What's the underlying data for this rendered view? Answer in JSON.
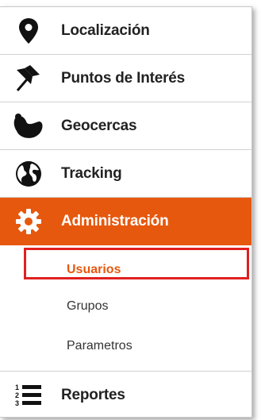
{
  "menu": {
    "items": [
      {
        "label": "Localización",
        "icon": "location-pin-icon"
      },
      {
        "label": "Puntos de Interés",
        "icon": "pushpin-icon"
      },
      {
        "label": "Geocercas",
        "icon": "geofence-icon"
      },
      {
        "label": "Tracking",
        "icon": "globe-icon"
      },
      {
        "label": "Administración",
        "icon": "gear-icon"
      }
    ],
    "subitems": [
      {
        "label": "Usuarios"
      },
      {
        "label": "Grupos"
      },
      {
        "label": "Parametros"
      }
    ],
    "reports": {
      "label": "Reportes",
      "icon": "numbered-list-icon"
    }
  },
  "colors": {
    "accent": "#e6580e",
    "highlight": "#e02020"
  }
}
